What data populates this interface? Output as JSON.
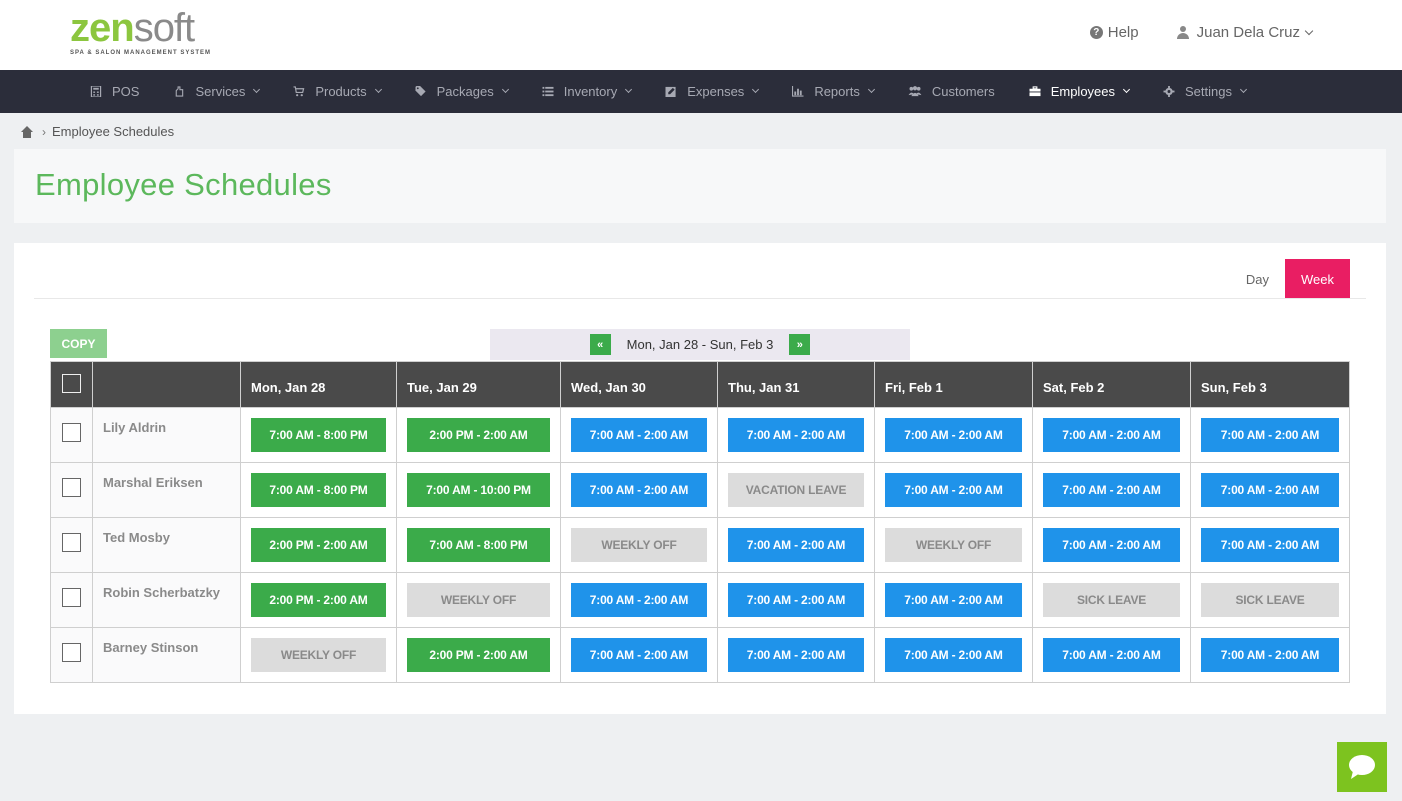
{
  "brand": {
    "name_part1": "zen",
    "name_part2": "soft",
    "tagline": "SPA & SALON MANAGEMENT SYSTEM",
    "accent_color": "#8cc63f"
  },
  "header": {
    "help_label": "Help",
    "user_name": "Juan Dela Cruz"
  },
  "nav": {
    "items": [
      {
        "label": "POS",
        "icon": "calculator-icon",
        "has_dropdown": false
      },
      {
        "label": "Services",
        "icon": "hand-icon",
        "has_dropdown": true
      },
      {
        "label": "Products",
        "icon": "cart-icon",
        "has_dropdown": true
      },
      {
        "label": "Packages",
        "icon": "tags-icon",
        "has_dropdown": true
      },
      {
        "label": "Inventory",
        "icon": "list-icon",
        "has_dropdown": true
      },
      {
        "label": "Expenses",
        "icon": "edit-icon",
        "has_dropdown": true
      },
      {
        "label": "Reports",
        "icon": "bar-chart-icon",
        "has_dropdown": true
      },
      {
        "label": "Customers",
        "icon": "users-icon",
        "has_dropdown": false
      },
      {
        "label": "Employees",
        "icon": "briefcase-icon",
        "has_dropdown": true,
        "active": true
      },
      {
        "label": "Settings",
        "icon": "gear-icon",
        "has_dropdown": true
      }
    ],
    "background": "#2b2d3a"
  },
  "breadcrumb": {
    "current": "Employee Schedules"
  },
  "page": {
    "title": "Employee Schedules",
    "title_color": "#5cb85c"
  },
  "view_toggle": {
    "day_label": "Day",
    "week_label": "Week",
    "active": "Week",
    "active_color": "#e91e63"
  },
  "toolbar": {
    "copy_label": "COPY",
    "prev_label": "«",
    "next_label": "»",
    "week_range": "Mon, Jan 28 - Sun, Feb 3"
  },
  "schedule": {
    "days": [
      "Mon, Jan 28",
      "Tue, Jan 29",
      "Wed, Jan 30",
      "Thu, Jan 31",
      "Fri, Feb 1",
      "Sat, Feb 2",
      "Sun, Feb 3"
    ],
    "status_colors": {
      "green": "#3bab4a",
      "blue": "#1f93ea",
      "gray": "#dcdcdc"
    },
    "rows": [
      {
        "name": "Lily Aldrin",
        "shifts": [
          {
            "text": "7:00 AM - 8:00 PM",
            "style": "green"
          },
          {
            "text": "2:00 PM - 2:00 AM",
            "style": "green"
          },
          {
            "text": "7:00 AM - 2:00 AM",
            "style": "blue"
          },
          {
            "text": "7:00 AM - 2:00 AM",
            "style": "blue"
          },
          {
            "text": "7:00 AM - 2:00 AM",
            "style": "blue"
          },
          {
            "text": "7:00 AM - 2:00 AM",
            "style": "blue"
          },
          {
            "text": "7:00 AM - 2:00 AM",
            "style": "blue"
          }
        ]
      },
      {
        "name": "Marshal Eriksen",
        "shifts": [
          {
            "text": "7:00 AM - 8:00 PM",
            "style": "green"
          },
          {
            "text": "7:00 AM - 10:00 PM",
            "style": "green"
          },
          {
            "text": "7:00 AM - 2:00 AM",
            "style": "blue"
          },
          {
            "text": "VACATION LEAVE",
            "style": "gray"
          },
          {
            "text": "7:00 AM - 2:00 AM",
            "style": "blue"
          },
          {
            "text": "7:00 AM - 2:00 AM",
            "style": "blue"
          },
          {
            "text": "7:00 AM - 2:00 AM",
            "style": "blue"
          }
        ]
      },
      {
        "name": "Ted Mosby",
        "shifts": [
          {
            "text": "2:00 PM - 2:00 AM",
            "style": "green"
          },
          {
            "text": "7:00 AM - 8:00 PM",
            "style": "green"
          },
          {
            "text": "WEEKLY OFF",
            "style": "gray"
          },
          {
            "text": "7:00 AM - 2:00 AM",
            "style": "blue"
          },
          {
            "text": "WEEKLY OFF",
            "style": "gray"
          },
          {
            "text": "7:00 AM - 2:00 AM",
            "style": "blue"
          },
          {
            "text": "7:00 AM - 2:00 AM",
            "style": "blue"
          }
        ]
      },
      {
        "name": "Robin Scherbatzky",
        "shifts": [
          {
            "text": "2:00 PM - 2:00 AM",
            "style": "green"
          },
          {
            "text": "WEEKLY OFF",
            "style": "gray"
          },
          {
            "text": "7:00 AM - 2:00 AM",
            "style": "blue"
          },
          {
            "text": "7:00 AM - 2:00 AM",
            "style": "blue"
          },
          {
            "text": "7:00 AM - 2:00 AM",
            "style": "blue"
          },
          {
            "text": "SICK LEAVE",
            "style": "gray"
          },
          {
            "text": "SICK LEAVE",
            "style": "gray"
          }
        ]
      },
      {
        "name": "Barney Stinson",
        "shifts": [
          {
            "text": "WEEKLY OFF",
            "style": "gray"
          },
          {
            "text": "2:00 PM - 2:00 AM",
            "style": "green"
          },
          {
            "text": "7:00 AM - 2:00 AM",
            "style": "blue"
          },
          {
            "text": "7:00 AM - 2:00 AM",
            "style": "blue"
          },
          {
            "text": "7:00 AM - 2:00 AM",
            "style": "blue"
          },
          {
            "text": "7:00 AM - 2:00 AM",
            "style": "blue"
          },
          {
            "text": "7:00 AM - 2:00 AM",
            "style": "blue"
          }
        ]
      }
    ]
  },
  "chat": {
    "icon": "chat-bubble-icon",
    "color": "#7dc31f"
  }
}
